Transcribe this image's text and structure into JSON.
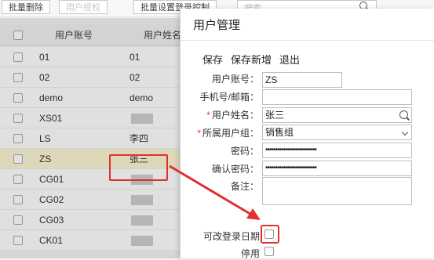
{
  "toolbar": {
    "batch_delete": "批量删除",
    "user_auth": "用户授权",
    "batch_login_ctrl": "批量设置登录控制",
    "search_placeholder": "搜索"
  },
  "grid": {
    "col_account": "用户账号",
    "col_name": "用户姓名",
    "rows": [
      {
        "account": "01",
        "name": "01"
      },
      {
        "account": "02",
        "name": "02"
      },
      {
        "account": "demo",
        "name": "demo"
      },
      {
        "account": "XS01",
        "name": ""
      },
      {
        "account": "LS",
        "name": "李四"
      },
      {
        "account": "ZS",
        "name": "张三"
      },
      {
        "account": "CG01",
        "name": ""
      },
      {
        "account": "CG02",
        "name": ""
      },
      {
        "account": "CG03",
        "name": ""
      },
      {
        "account": "CK01",
        "name": ""
      }
    ]
  },
  "dialog": {
    "title": "用户管理",
    "actions": {
      "save": "保存",
      "save_new": "保存新增",
      "exit": "退出"
    },
    "form": {
      "account_label": "用户账号：",
      "account_value": "ZS",
      "phone_label": "手机号/邮箱：",
      "phone_value": "",
      "name_label": "用户姓名：",
      "name_value": "张三",
      "group_label": "所属用户组：",
      "group_value": "销售组",
      "password_label": "密码：",
      "password_value": "••••••••••••••••••••••••••",
      "confirm_label": "确认密码：",
      "confirm_value": "••••••••••••••••••••••••••",
      "remark_label": "备注：",
      "remark_value": "",
      "change_date_label": "可改登录日期",
      "disable_label": "停用"
    }
  },
  "colors": {
    "highlight_red": "#e03131",
    "selected_row": "#fdf6d4"
  }
}
